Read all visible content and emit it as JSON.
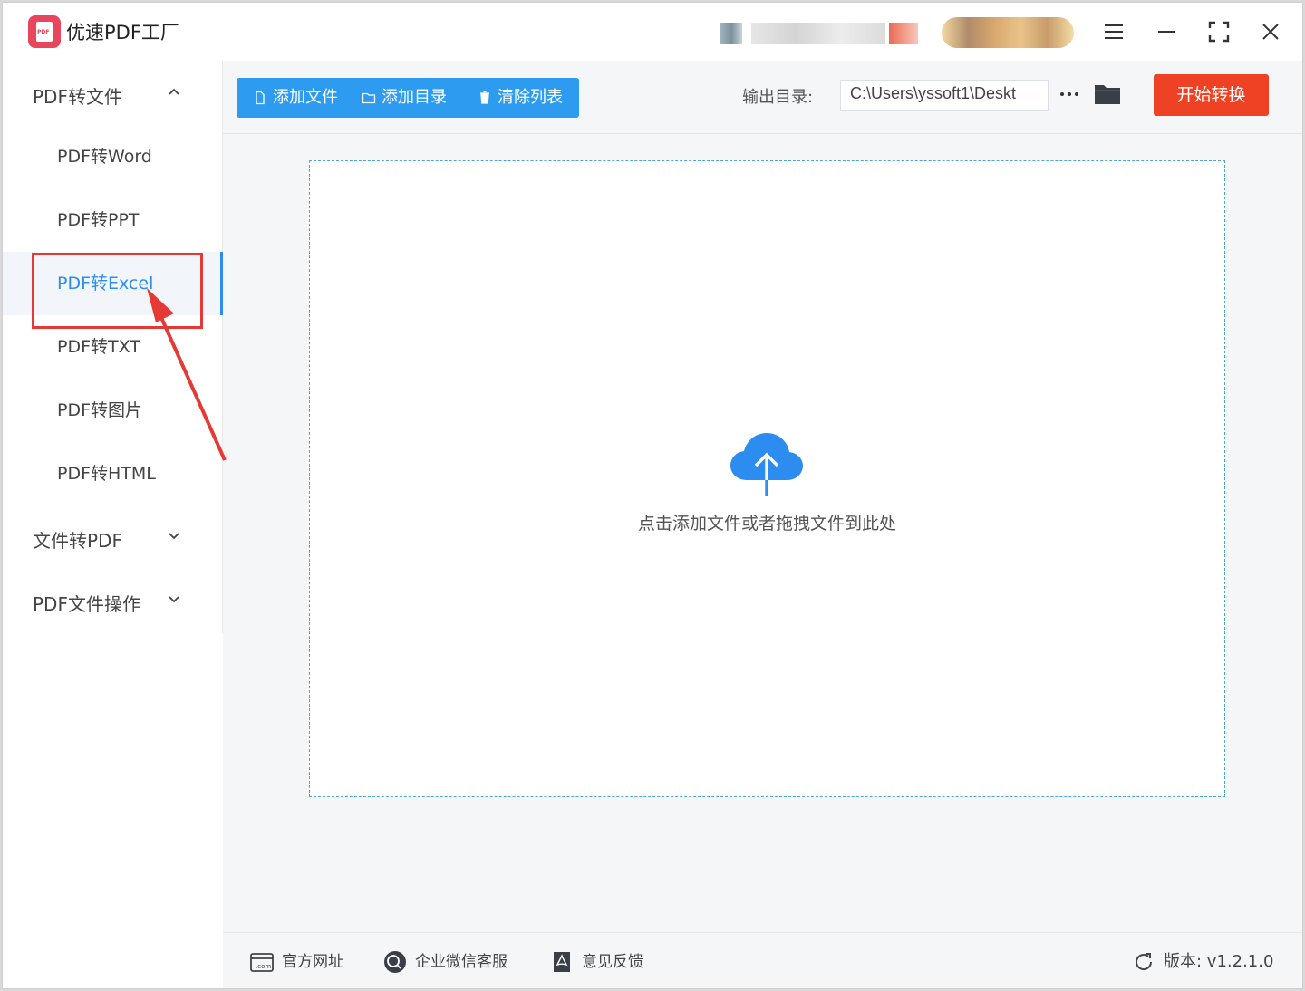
{
  "window": {
    "title": "优速PDF工厂",
    "logo_text": "PDF"
  },
  "sidebar": {
    "groups": [
      {
        "label": "PDF转文件",
        "expanded": true
      },
      {
        "label": "文件转PDF",
        "expanded": false
      },
      {
        "label": "PDF文件操作",
        "expanded": false
      }
    ],
    "items": [
      {
        "label": "PDF转Word"
      },
      {
        "label": "PDF转PPT"
      },
      {
        "label": "PDF转Excel",
        "active": true
      },
      {
        "label": "PDF转TXT"
      },
      {
        "label": "PDF转图片"
      },
      {
        "label": "PDF转HTML"
      }
    ]
  },
  "toolbar": {
    "add_file": "添加文件",
    "add_dir": "添加目录",
    "clear_list": "清除列表",
    "output_label": "输出目录:",
    "output_path": "C:\\Users\\yssoft1\\Deskt",
    "more": "···",
    "start": "开始转换"
  },
  "dropzone": {
    "hint": "点击添加文件或者拖拽文件到此处"
  },
  "footer": {
    "site": "官方网址",
    "wechat": "企业微信客服",
    "feedback": "意见反馈",
    "version": "版本: v1.2.1.0"
  },
  "colors": {
    "accent": "#2d9cf0",
    "start_button": "#ef4224",
    "annotation": "#e53935",
    "logo": "#e8465d"
  },
  "icons": [
    "pdf-logo-icon",
    "menu-icon",
    "minimize-icon",
    "maximize-icon",
    "close-icon",
    "chevron-up-icon",
    "chevron-down-icon",
    "file-icon",
    "folder-outline-icon",
    "trash-icon",
    "more-icon",
    "folder-icon",
    "cloud-upload-icon",
    "web-icon",
    "wechat-icon",
    "feedback-icon",
    "refresh-icon"
  ]
}
